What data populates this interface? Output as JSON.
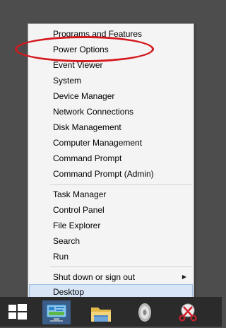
{
  "menu": {
    "group1": [
      "Programs and Features",
      "Power Options",
      "Event Viewer",
      "System",
      "Device Manager",
      "Network Connections",
      "Disk Management",
      "Computer Management",
      "Command Prompt",
      "Command Prompt (Admin)"
    ],
    "group2": [
      "Task Manager",
      "Control Panel",
      "File Explorer",
      "Search",
      "Run"
    ],
    "shutdown": "Shut down or sign out",
    "desktop": "Desktop"
  },
  "highlight_color": "#d4191f",
  "taskbar": {
    "icons": [
      "windows-start-icon",
      "control-panel-icon",
      "file-explorer-icon",
      "speaker-icon",
      "snipping-tool-icon"
    ]
  }
}
